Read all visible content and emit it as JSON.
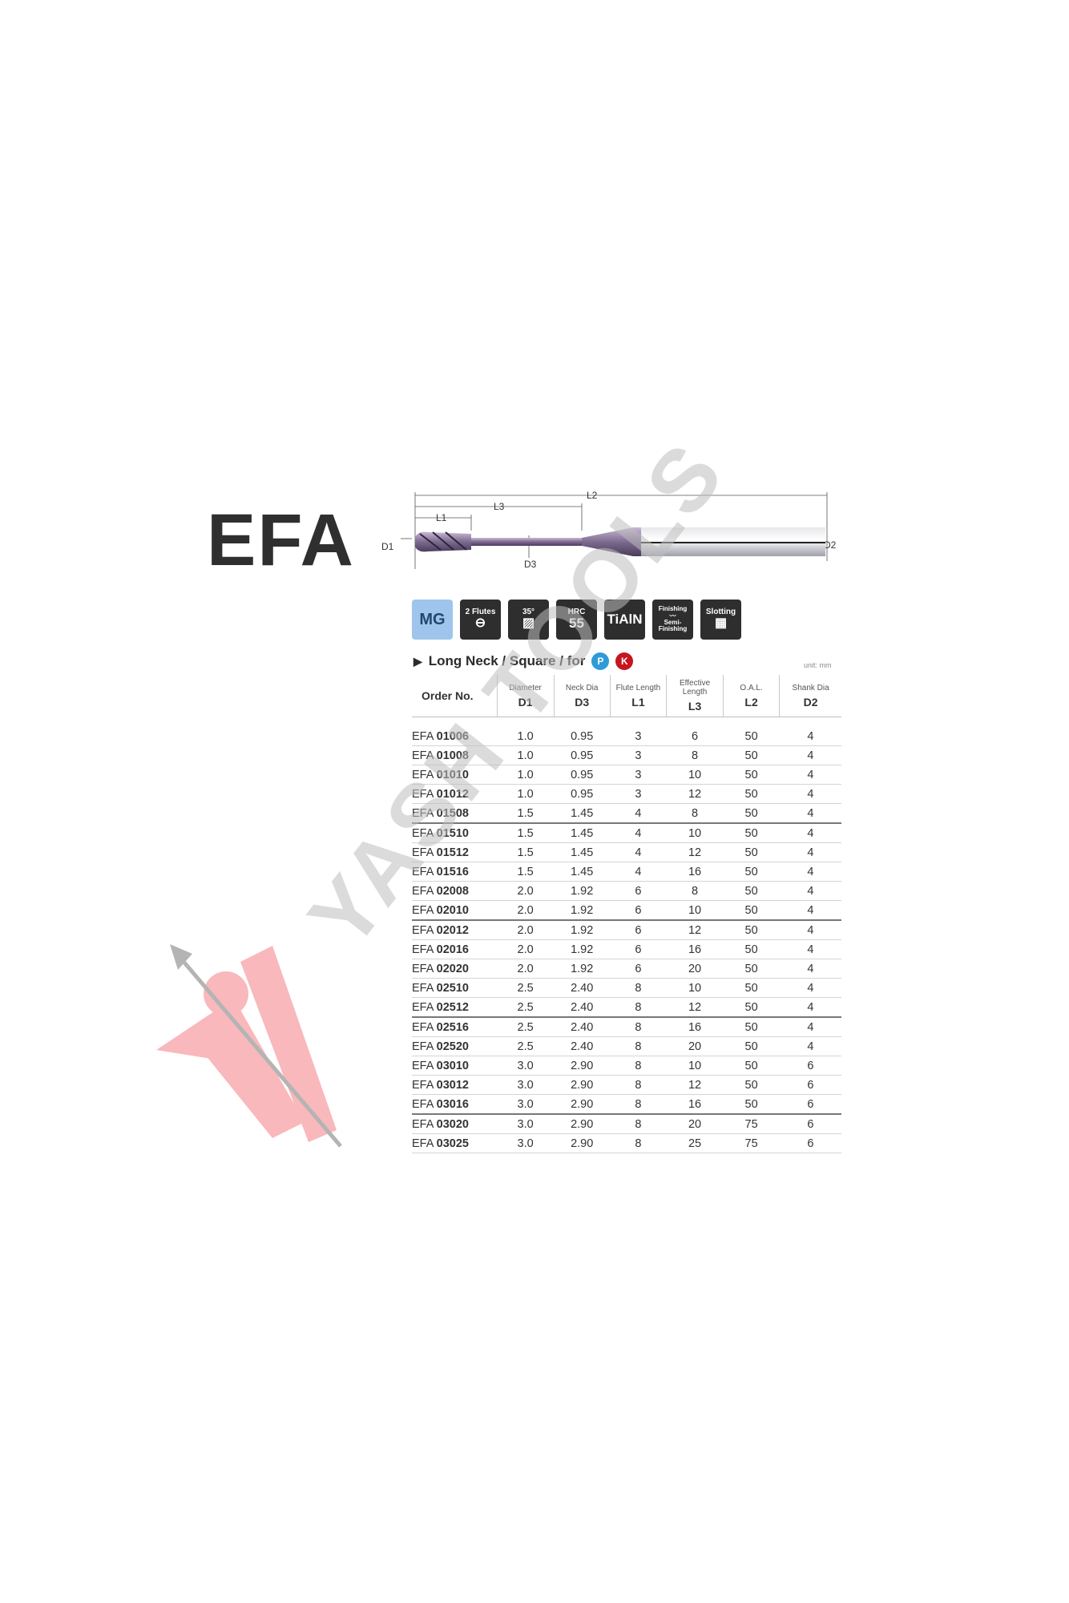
{
  "product": {
    "title": "EFA"
  },
  "diagram": {
    "l2": "L2",
    "l3": "L3",
    "l1": "L1",
    "d1": "D1",
    "d2": "D2",
    "d3": "D3"
  },
  "icons": {
    "material": "MG",
    "flutes_num": "2",
    "flutes_label": "Flutes",
    "helix": "35°",
    "hardness_label": "HRC",
    "hardness_value": "55",
    "coating": "TiAlN",
    "finishing_top": "Finishing",
    "finishing_bottom": "Semi-Finishing",
    "slotting": "Slotting"
  },
  "subtitle": {
    "text": "Long Neck / Square / for",
    "badge_p": "P",
    "badge_k": "K",
    "unit": "unit: mm"
  },
  "table": {
    "headers": [
      {
        "label": "Order No.",
        "code": ""
      },
      {
        "label": "Diameter",
        "code": "D1"
      },
      {
        "label": "Neck Dia",
        "code": "D3"
      },
      {
        "label": "Flute Length",
        "code": "L1"
      },
      {
        "label": "Effective Length",
        "code": "L3"
      },
      {
        "label": "O.A.L.",
        "code": "L2"
      },
      {
        "label": "Shank Dia",
        "code": "D2"
      }
    ],
    "rows": [
      {
        "prefix": "EFA",
        "num": "01006",
        "d1": "1.0",
        "d3": "0.95",
        "l1": "3",
        "l3": "6",
        "l2": "50",
        "d2": "4"
      },
      {
        "prefix": "EFA",
        "num": "01008",
        "d1": "1.0",
        "d3": "0.95",
        "l1": "3",
        "l3": "8",
        "l2": "50",
        "d2": "4"
      },
      {
        "prefix": "EFA",
        "num": "01010",
        "d1": "1.0",
        "d3": "0.95",
        "l1": "3",
        "l3": "10",
        "l2": "50",
        "d2": "4"
      },
      {
        "prefix": "EFA",
        "num": "01012",
        "d1": "1.0",
        "d3": "0.95",
        "l1": "3",
        "l3": "12",
        "l2": "50",
        "d2": "4"
      },
      {
        "prefix": "EFA",
        "num": "01508",
        "d1": "1.5",
        "d3": "1.45",
        "l1": "4",
        "l3": "8",
        "l2": "50",
        "d2": "4"
      },
      {
        "prefix": "EFA",
        "num": "01510",
        "d1": "1.5",
        "d3": "1.45",
        "l1": "4",
        "l3": "10",
        "l2": "50",
        "d2": "4"
      },
      {
        "prefix": "EFA",
        "num": "01512",
        "d1": "1.5",
        "d3": "1.45",
        "l1": "4",
        "l3": "12",
        "l2": "50",
        "d2": "4"
      },
      {
        "prefix": "EFA",
        "num": "01516",
        "d1": "1.5",
        "d3": "1.45",
        "l1": "4",
        "l3": "16",
        "l2": "50",
        "d2": "4"
      },
      {
        "prefix": "EFA",
        "num": "02008",
        "d1": "2.0",
        "d3": "1.92",
        "l1": "6",
        "l3": "8",
        "l2": "50",
        "d2": "4"
      },
      {
        "prefix": "EFA",
        "num": "02010",
        "d1": "2.0",
        "d3": "1.92",
        "l1": "6",
        "l3": "10",
        "l2": "50",
        "d2": "4"
      },
      {
        "prefix": "EFA",
        "num": "02012",
        "d1": "2.0",
        "d3": "1.92",
        "l1": "6",
        "l3": "12",
        "l2": "50",
        "d2": "4"
      },
      {
        "prefix": "EFA",
        "num": "02016",
        "d1": "2.0",
        "d3": "1.92",
        "l1": "6",
        "l3": "16",
        "l2": "50",
        "d2": "4"
      },
      {
        "prefix": "EFA",
        "num": "02020",
        "d1": "2.0",
        "d3": "1.92",
        "l1": "6",
        "l3": "20",
        "l2": "50",
        "d2": "4"
      },
      {
        "prefix": "EFA",
        "num": "02510",
        "d1": "2.5",
        "d3": "2.40",
        "l1": "8",
        "l3": "10",
        "l2": "50",
        "d2": "4"
      },
      {
        "prefix": "EFA",
        "num": "02512",
        "d1": "2.5",
        "d3": "2.40",
        "l1": "8",
        "l3": "12",
        "l2": "50",
        "d2": "4"
      },
      {
        "prefix": "EFA",
        "num": "02516",
        "d1": "2.5",
        "d3": "2.40",
        "l1": "8",
        "l3": "16",
        "l2": "50",
        "d2": "4"
      },
      {
        "prefix": "EFA",
        "num": "02520",
        "d1": "2.5",
        "d3": "2.40",
        "l1": "8",
        "l3": "20",
        "l2": "50",
        "d2": "4"
      },
      {
        "prefix": "EFA",
        "num": "03010",
        "d1": "3.0",
        "d3": "2.90",
        "l1": "8",
        "l3": "10",
        "l2": "50",
        "d2": "6"
      },
      {
        "prefix": "EFA",
        "num": "03012",
        "d1": "3.0",
        "d3": "2.90",
        "l1": "8",
        "l3": "12",
        "l2": "50",
        "d2": "6"
      },
      {
        "prefix": "EFA",
        "num": "03016",
        "d1": "3.0",
        "d3": "2.90",
        "l1": "8",
        "l3": "16",
        "l2": "50",
        "d2": "6"
      },
      {
        "prefix": "EFA",
        "num": "03020",
        "d1": "3.0",
        "d3": "2.90",
        "l1": "8",
        "l3": "20",
        "l2": "75",
        "d2": "6"
      },
      {
        "prefix": "EFA",
        "num": "03025",
        "d1": "3.0",
        "d3": "2.90",
        "l1": "8",
        "l3": "25",
        "l2": "75",
        "d2": "6"
      }
    ]
  },
  "watermark": {
    "text": "YASH TOOLS"
  },
  "colors": {
    "mg_badge": "#9fc5ec",
    "icon_bg": "#2e2e2e",
    "badge_p": "#2f9ad8",
    "badge_k": "#c5161d",
    "watermark_logo": "#f47f86",
    "watermark_text": "#bdbdbd"
  }
}
